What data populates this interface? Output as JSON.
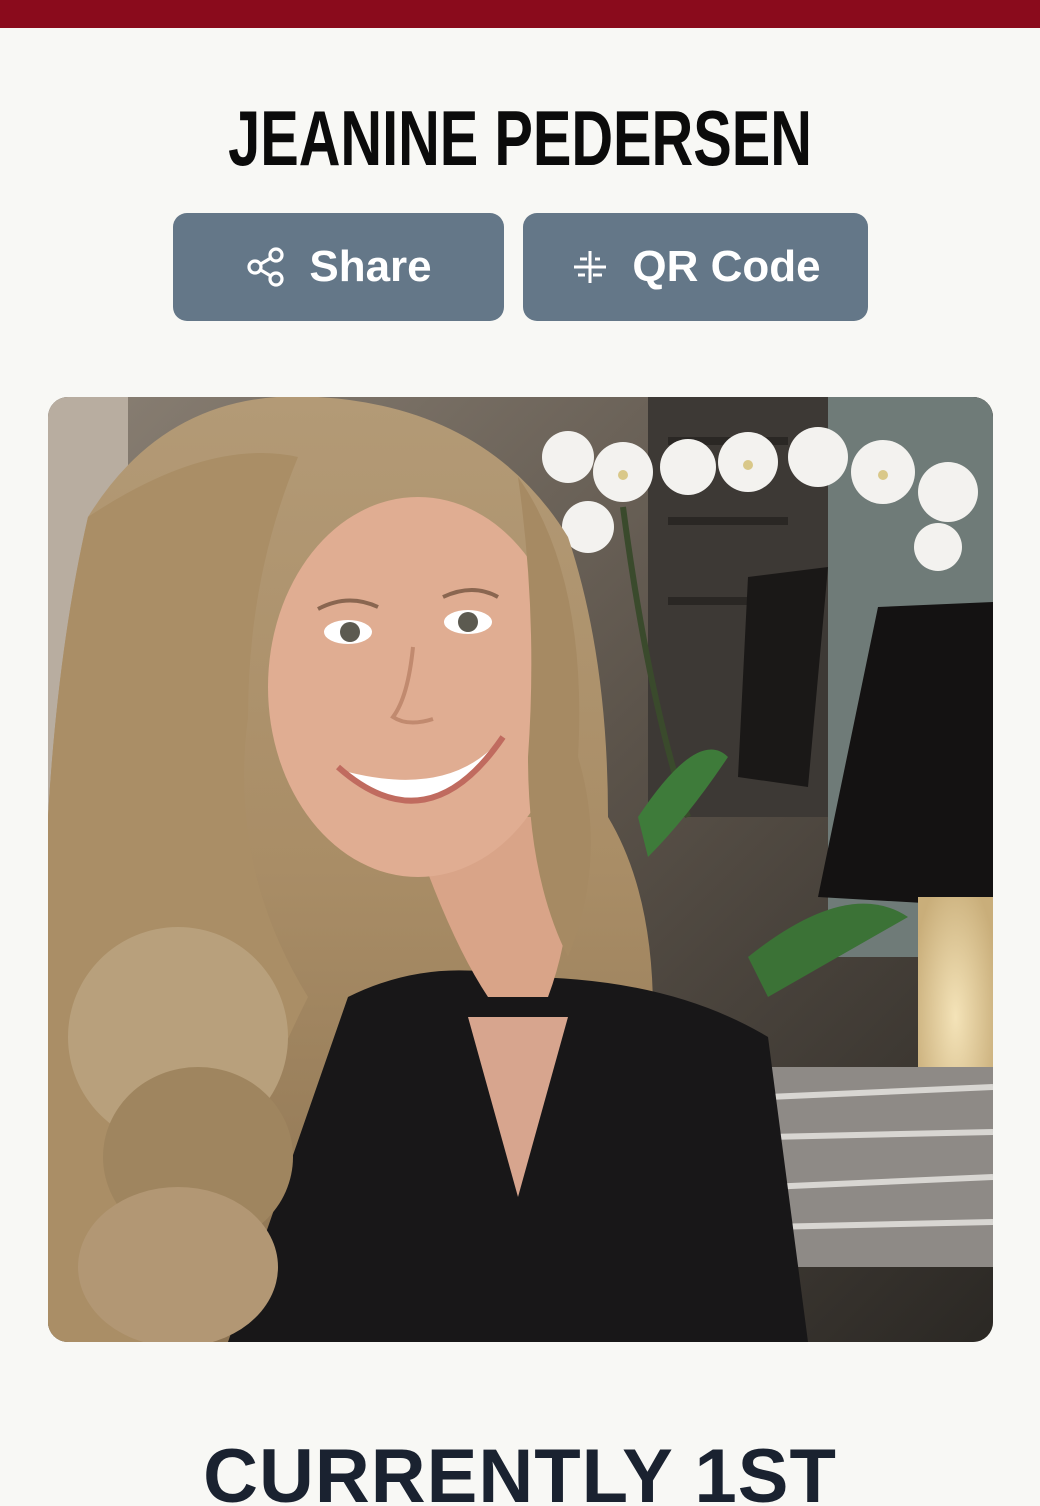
{
  "header": {
    "accent_color": "#8a0b1c"
  },
  "profile": {
    "name": "JEANINE PEDERSEN",
    "photo_alt": ""
  },
  "actions": {
    "share": {
      "label": "Share",
      "icon": "share-icon"
    },
    "qr": {
      "label": "QR Code",
      "icon": "qr-code-icon"
    },
    "button_color": "#647788"
  },
  "status": {
    "heading": "CURRENTLY 1ST"
  }
}
